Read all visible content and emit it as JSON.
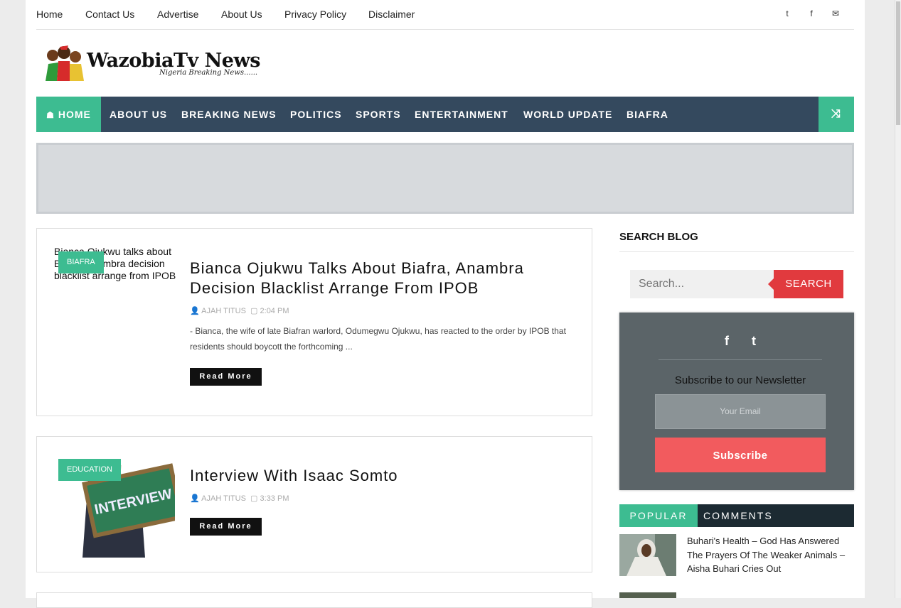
{
  "top_links": [
    "Home",
    "Contact Us",
    "Advertise",
    "About Us",
    "Privacy Policy",
    "Disclaimer"
  ],
  "social_top": [
    {
      "icon": "twitter-icon",
      "glyph": "t"
    },
    {
      "icon": "facebook-icon",
      "glyph": "f"
    },
    {
      "icon": "envelope-icon",
      "glyph": "✉"
    }
  ],
  "logo": {
    "title": "WazobiaTv News",
    "subtitle": "Nigeria Breaking News......"
  },
  "nav": {
    "home": "HOME",
    "items": [
      "ABOUT US",
      "BREAKING NEWS",
      "POLITICS",
      "SPORTS",
      "ENTERTAINMENT",
      "WORLD UPDATE",
      "BIAFRA"
    ],
    "shuffle_icon": "shuffle-icon"
  },
  "posts": [
    {
      "badge": "BIAFRA",
      "thumb_alt": "Bianca Ojukwu talks about Biafra, Anambra decision blacklist arrange from IPOB",
      "title": "Bianca Ojukwu Talks About Biafra, Anambra Decision Blacklist Arrange From IPOB",
      "author": "AJAH TITUS",
      "time": "2:04 PM",
      "excerpt": "- Bianca, the wife of late Biafran warlord, Odumegwu Ojukwu, has reacted to the order by IPOB that residents should boycott the forthcoming ...",
      "read_more": "Read More"
    },
    {
      "badge": "EDUCATION",
      "thumb_text": "INTERVIEW",
      "title": "Interview With Isaac Somto",
      "author": "AJAH TITUS",
      "time": "3:33 PM",
      "read_more": "Read More"
    }
  ],
  "sidebar": {
    "search_title": "SEARCH BLOG",
    "search_placeholder": "Search...",
    "search_button": "SEARCH",
    "newsletter": {
      "title": "Subscribe to our Newsletter",
      "email_placeholder": "Your Email",
      "button": "Subscribe"
    },
    "tabs": [
      "POPULAR",
      "COMMENTS"
    ],
    "popular": [
      {
        "title": "Buhari's Health – God Has Answered The Prayers Of The Weaker Animals – Aisha Buhari Cries Out"
      }
    ]
  },
  "colors": {
    "accent": "#3dbc91",
    "nav_bg": "#34495e",
    "search_red": "#e13a3e",
    "subscribe": "#f25b5e"
  }
}
